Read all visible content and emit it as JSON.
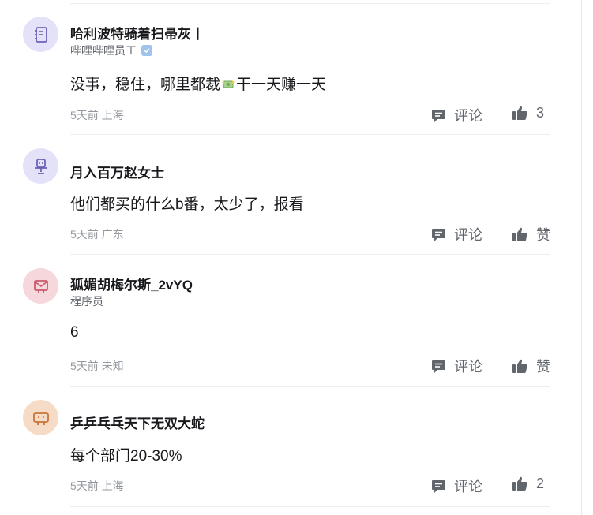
{
  "comments": [
    {
      "name": "哈利波特骑着扫帚灰丨",
      "role": "哔哩哔哩员工",
      "content_before": "没事，稳住，哪里都裁",
      "content_after": "干一天赚一天",
      "time": "5天前",
      "location": "上海",
      "comment_label": "评论",
      "like_label": "3",
      "avatar_icon": "notebook-icon",
      "avatar_bg": "#e4e2f8"
    },
    {
      "name": "月入百万赵女士",
      "content": "他们都买的什么b番，太少了，报看",
      "time": "5天前",
      "location": "广东",
      "comment_label": "评论",
      "like_label": "赞",
      "avatar_icon": "chair-icon",
      "avatar_bg": "#e4e2f8"
    },
    {
      "name": "狐媚胡梅尔斯_2vYQ",
      "role": "程序员",
      "content": "6",
      "time": "5天前",
      "location": "未知",
      "comment_label": "评论",
      "like_label": "赞",
      "avatar_icon": "envelope-icon",
      "avatar_bg": "#f6d8dc"
    },
    {
      "name": "乒乒乓乓天下无双大蛇",
      "content": "每个部门20-30%",
      "time": "5天前",
      "location": "上海",
      "comment_label": "评论",
      "like_label": "2",
      "avatar_icon": "wallet-icon",
      "avatar_bg": "#f6dcc6"
    }
  ],
  "icons": {
    "comment": "comment-bubble-icon",
    "like": "thumbs-up-icon",
    "emoji": "money-wings-emoji-icon",
    "verified": "verified-badge-icon"
  },
  "colors": {
    "name": "#18191c",
    "meta": "#9499a0",
    "action": "#61666d",
    "divider": "#eceef2"
  }
}
